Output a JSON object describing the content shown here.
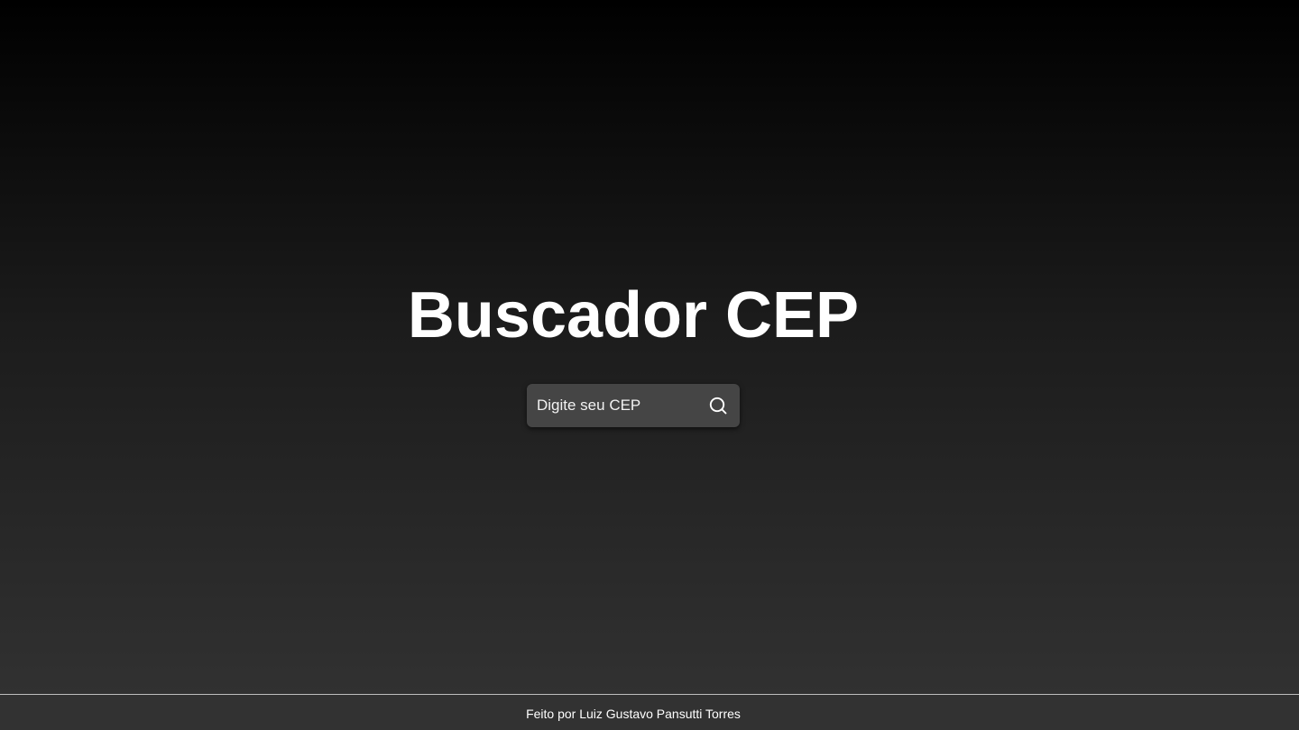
{
  "page": {
    "title": "Buscador CEP"
  },
  "search": {
    "placeholder": "Digite seu CEP",
    "value": "",
    "button_icon": "search-icon"
  },
  "footer": {
    "text": "Feito por Luiz Gustavo Pansutti Torres"
  },
  "colors": {
    "background_top": "#000000",
    "background_bottom": "#333333",
    "search_box": "#454545",
    "footer_background": "#323232",
    "footer_border": "#bdbdbd",
    "text": "#ffffff"
  }
}
